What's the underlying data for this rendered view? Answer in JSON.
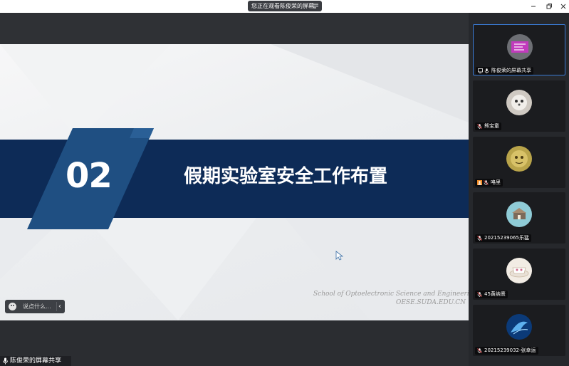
{
  "top_bar": {
    "share_notice": "您正在观看陈俊荣的屏幕"
  },
  "slide": {
    "section_number": "02",
    "title": "假期实验室安全工作布置",
    "school_line1": "School of Optoelectronic Science and Engineering",
    "school_line2": "OESE.SUDA.EDU.CN",
    "band_color": "#0d2b57",
    "accent_color": "#1f4f82"
  },
  "comment_bar": {
    "placeholder": "说点什么..."
  },
  "presenter": {
    "label": "陈俊荣的屏幕共享"
  },
  "participants": [
    {
      "name": "陈俊荣的屏幕共享",
      "active": true
    },
    {
      "name": "熊宝童",
      "active": false
    },
    {
      "name": "咯里",
      "active": false
    },
    {
      "name": "20215239065乐猛",
      "active": false
    },
    {
      "name": "45黄纳熹",
      "active": false
    },
    {
      "name": "20215239032-张幸运",
      "active": false
    }
  ]
}
